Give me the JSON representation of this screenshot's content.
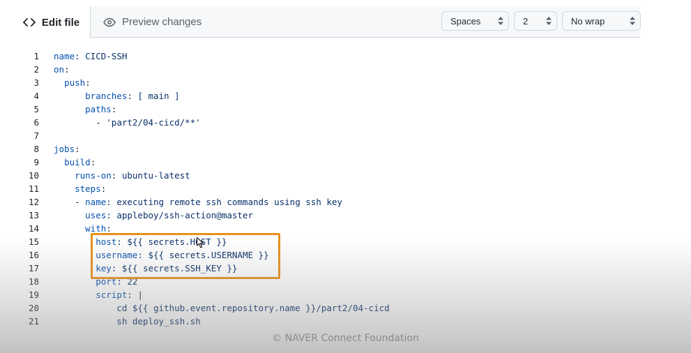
{
  "tabs": {
    "edit_label": "Edit file",
    "preview_label": "Preview changes"
  },
  "options": {
    "indent_mode": "Spaces",
    "indent_size": "2",
    "wrap_mode": "No wrap"
  },
  "editor": {
    "lines": [
      {
        "n": "1",
        "segments": [
          {
            "t": "",
            "c": ""
          },
          {
            "t": "name",
            "c": "k"
          },
          {
            "t": ": CICD-SSH",
            "c": "v"
          }
        ]
      },
      {
        "n": "2",
        "segments": [
          {
            "t": "",
            "c": ""
          },
          {
            "t": "on",
            "c": "k"
          },
          {
            "t": ":",
            "c": ""
          }
        ]
      },
      {
        "n": "3",
        "segments": [
          {
            "t": "  ",
            "c": ""
          },
          {
            "t": "push",
            "c": "k"
          },
          {
            "t": ":",
            "c": ""
          }
        ]
      },
      {
        "n": "4",
        "segments": [
          {
            "t": "      ",
            "c": ""
          },
          {
            "t": "branches",
            "c": "k"
          },
          {
            "t": ": [ main ]",
            "c": "v"
          }
        ]
      },
      {
        "n": "5",
        "segments": [
          {
            "t": "      ",
            "c": ""
          },
          {
            "t": "paths",
            "c": "k"
          },
          {
            "t": ":",
            "c": ""
          }
        ]
      },
      {
        "n": "6",
        "segments": [
          {
            "t": "        - ",
            "c": ""
          },
          {
            "t": "'part2/04-cicd/**'",
            "c": "v"
          }
        ]
      },
      {
        "n": "7",
        "segments": [
          {
            "t": "",
            "c": ""
          }
        ]
      },
      {
        "n": "8",
        "segments": [
          {
            "t": "",
            "c": ""
          },
          {
            "t": "jobs",
            "c": "k"
          },
          {
            "t": ":",
            "c": ""
          }
        ]
      },
      {
        "n": "9",
        "segments": [
          {
            "t": "  ",
            "c": ""
          },
          {
            "t": "build",
            "c": "k"
          },
          {
            "t": ":",
            "c": ""
          }
        ]
      },
      {
        "n": "10",
        "segments": [
          {
            "t": "    ",
            "c": ""
          },
          {
            "t": "runs-on",
            "c": "k"
          },
          {
            "t": ": ubuntu-latest",
            "c": "v"
          }
        ]
      },
      {
        "n": "11",
        "segments": [
          {
            "t": "    ",
            "c": ""
          },
          {
            "t": "steps",
            "c": "k"
          },
          {
            "t": ":",
            "c": ""
          }
        ]
      },
      {
        "n": "12",
        "segments": [
          {
            "t": "    - ",
            "c": ""
          },
          {
            "t": "name",
            "c": "k"
          },
          {
            "t": ": executing remote ssh commands using ssh key",
            "c": "v"
          }
        ]
      },
      {
        "n": "13",
        "segments": [
          {
            "t": "      ",
            "c": ""
          },
          {
            "t": "uses",
            "c": "k"
          },
          {
            "t": ": appleboy/ssh-action@master",
            "c": "v"
          }
        ]
      },
      {
        "n": "14",
        "segments": [
          {
            "t": "      ",
            "c": ""
          },
          {
            "t": "with",
            "c": "k"
          },
          {
            "t": ":",
            "c": ""
          }
        ]
      },
      {
        "n": "15",
        "segments": [
          {
            "t": "        ",
            "c": ""
          },
          {
            "t": "host",
            "c": "k"
          },
          {
            "t": ": ${{ secrets.HOST }}",
            "c": "v"
          }
        ]
      },
      {
        "n": "16",
        "segments": [
          {
            "t": "        ",
            "c": ""
          },
          {
            "t": "username",
            "c": "k"
          },
          {
            "t": ": ${{ secrets.USERNAME }}",
            "c": "v"
          }
        ]
      },
      {
        "n": "17",
        "segments": [
          {
            "t": "        ",
            "c": ""
          },
          {
            "t": "key",
            "c": "k"
          },
          {
            "t": ": ${{ secrets.SSH_KEY }}",
            "c": "v"
          }
        ]
      },
      {
        "n": "18",
        "segments": [
          {
            "t": "        ",
            "c": ""
          },
          {
            "t": "port",
            "c": "k"
          },
          {
            "t": ": 22",
            "c": "v"
          }
        ]
      },
      {
        "n": "19",
        "segments": [
          {
            "t": "        ",
            "c": ""
          },
          {
            "t": "script",
            "c": "k"
          },
          {
            "t": ": |",
            "c": ""
          }
        ]
      },
      {
        "n": "20",
        "segments": [
          {
            "t": "            cd ${{ github.event.repository.name }}/part2/04-cicd",
            "c": "v"
          }
        ]
      },
      {
        "n": "21",
        "segments": [
          {
            "t": "            sh deploy_ssh.sh",
            "c": "v"
          }
        ]
      }
    ]
  },
  "watermark": "©  NAVER Connect Foundation",
  "colors": {
    "highlight": "#e8901a",
    "key": "#0550ae",
    "value": "#0a3069"
  },
  "icons": {
    "edit_tab": "code-icon",
    "preview_tab": "eye-icon",
    "select_arrows": "up-down-arrows-icon"
  }
}
